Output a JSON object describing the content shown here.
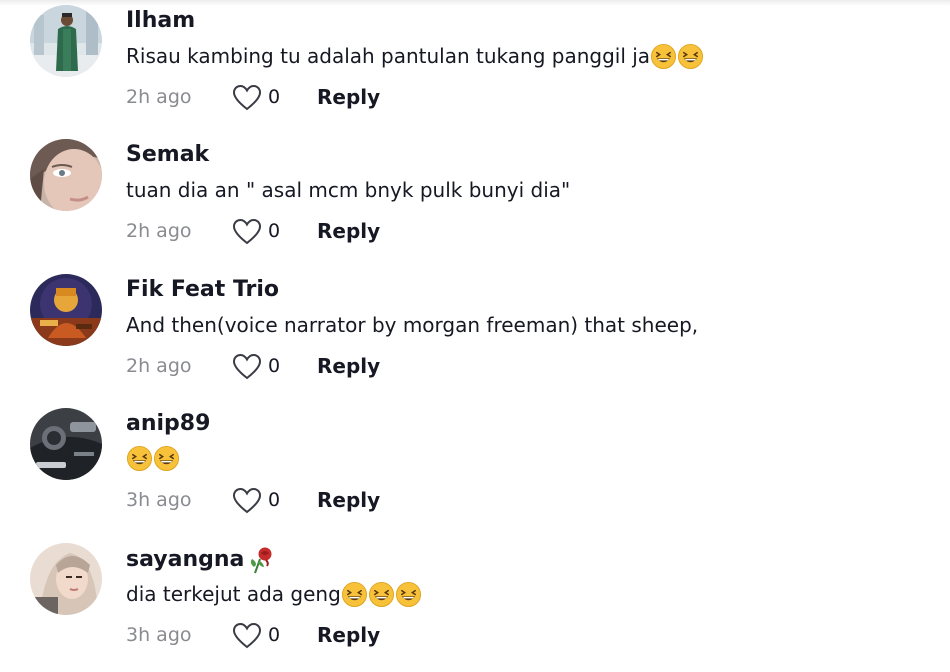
{
  "comments": [
    {
      "username": "Ilham",
      "text": "Risau kambing tu adalah pantulan tukang panggil ja",
      "emojis": [
        "grinning-squint-face",
        "grinning-squint-face"
      ],
      "time": "2h ago",
      "likes": "0",
      "reply_label": "Reply"
    },
    {
      "username": "Semak",
      "text": "tuan dia an \" asal mcm bnyk pulk bunyi dia\"",
      "emojis": [],
      "time": "2h ago",
      "likes": "0",
      "reply_label": "Reply"
    },
    {
      "username": "Fik Feat Trio",
      "text": "And then(voice narrator by morgan freeman) that sheep,",
      "emojis": [],
      "time": "2h ago",
      "likes": "0",
      "reply_label": "Reply"
    },
    {
      "username": "anip89",
      "text": "",
      "emojis": [
        "grinning-squint-face",
        "grinning-squint-face"
      ],
      "time": "3h ago",
      "likes": "0",
      "reply_label": "Reply"
    },
    {
      "username": "sayangna",
      "username_emoji": "wilted-rose",
      "text": "dia terkejut ada geng",
      "emojis": [
        "grinning-squint-face",
        "grinning-squint-face",
        "grinning-squint-face"
      ],
      "time": "3h ago",
      "likes": "0",
      "reply_label": "Reply"
    }
  ],
  "colors": {
    "text_primary": "#161823",
    "text_secondary": "#8a8b91",
    "emoji_face": "#f7c23a"
  }
}
